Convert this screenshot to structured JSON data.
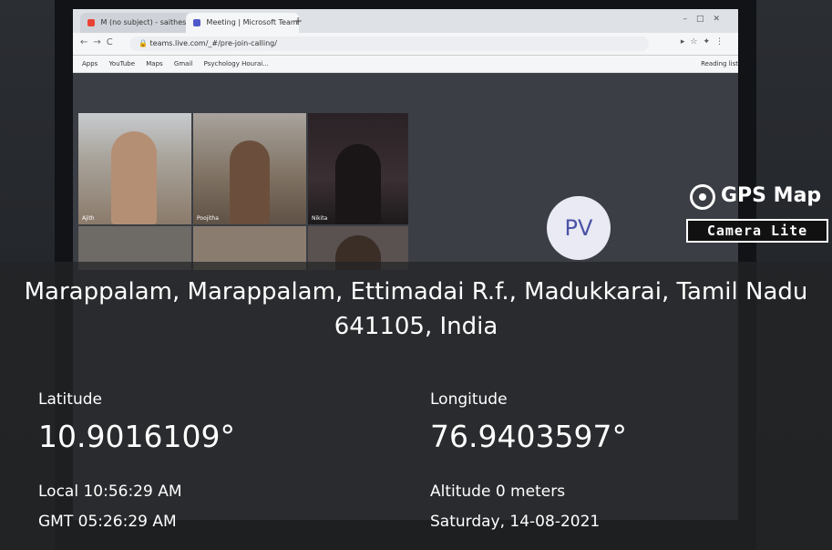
{
  "browser": {
    "tabs": [
      {
        "label": "M  (no subject) - saithesh",
        "icon_color": "#ea4335"
      },
      {
        "label": "Meeting | Microsoft Teams",
        "icon_color": "#5059c9"
      }
    ],
    "url": "teams.live.com/_#/pre-join-calling/",
    "bookmarks": [
      "Apps",
      "YouTube",
      "Maps",
      "Gmail",
      "Psychology Hourai..."
    ],
    "reading_list": "Reading list"
  },
  "meeting": {
    "avatar_initials": "PV",
    "tiles": [
      {
        "label": "Ajith"
      },
      {
        "label": "Poojitha"
      },
      {
        "label": "Nikita"
      }
    ]
  },
  "stamp_logo": {
    "title": "GPS Map",
    "subtitle": "Camera Lite"
  },
  "location": {
    "address": "Marappalam, Marappalam, Ettimadai R.f., Madukkarai, Tamil Nadu 641105, India",
    "latitude_label": "Latitude",
    "latitude_value": "10.9016109°",
    "longitude_label": "Longitude",
    "longitude_value": "76.9403597°",
    "local_time": "Local 10:56:29 AM",
    "gmt_time": "GMT 05:26:29 AM",
    "altitude": "Altitude 0 meters",
    "date": "Saturday, 14-08-2021"
  }
}
